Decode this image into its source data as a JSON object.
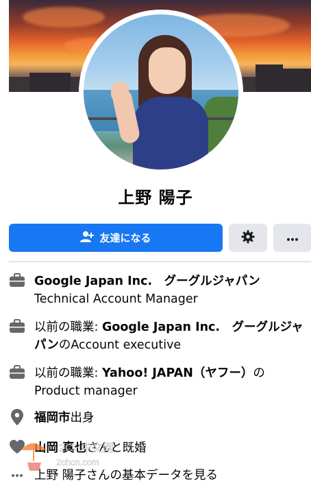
{
  "profile": {
    "name": "上野 陽子"
  },
  "actions": {
    "add_friend_label": "友達になる",
    "settings_icon": "gear-icon",
    "more_icon": "more-icon"
  },
  "intro": {
    "work_current_company": "Google Japan Inc.　グーグルジャパン",
    "work_current_title": "Technical Account Manager",
    "work_prev1_prefix": "以前の職業: ",
    "work_prev1_company": "Google Japan Inc.　グーグルジャ",
    "work_prev1_company_cont": "パン",
    "work_prev1_suffix": "のAccount executive",
    "work_prev2_prefix": "以前の職業: ",
    "work_prev2_company": "Yahoo! JAPAN（ヤフー）",
    "work_prev2_suffix": "の",
    "work_prev2_title": "Product manager",
    "hometown_city": "福岡市",
    "hometown_suffix": "出身",
    "relationship_partner": "山岡 真也",
    "relationship_suffix": "さんと既婚",
    "about_link": "上野 陽子さんの基本データを見る"
  },
  "watermark": {
    "line1": "2CH中文网",
    "line2": "2chcn.com"
  },
  "colors": {
    "primary": "#1877f2",
    "secondary_button": "#e4e6eb",
    "icon_gray": "#65676b",
    "text": "#050505"
  }
}
